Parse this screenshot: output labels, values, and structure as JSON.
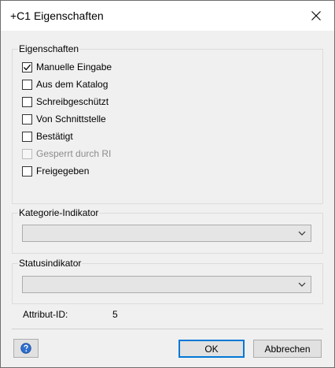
{
  "window": {
    "title": "+C1 Eigenschaften"
  },
  "properties": {
    "label": "Eigenschaften",
    "items": [
      {
        "label": "Manuelle Eingabe",
        "checked": true,
        "enabled": true
      },
      {
        "label": "Aus dem Katalog",
        "checked": false,
        "enabled": true
      },
      {
        "label": "Schreibgeschützt",
        "checked": false,
        "enabled": true
      },
      {
        "label": "Von Schnittstelle",
        "checked": false,
        "enabled": true
      },
      {
        "label": "Bestätigt",
        "checked": false,
        "enabled": true
      },
      {
        "label": "Gesperrt durch RI",
        "checked": false,
        "enabled": false
      },
      {
        "label": "Freigegeben",
        "checked": false,
        "enabled": true
      }
    ]
  },
  "category": {
    "label": "Kategorie-Indikator",
    "value": ""
  },
  "status": {
    "label": "Statusindikator",
    "value": ""
  },
  "attribute": {
    "label": "Attribut-ID:",
    "value": "5"
  },
  "buttons": {
    "ok": "OK",
    "cancel": "Abbrechen"
  }
}
